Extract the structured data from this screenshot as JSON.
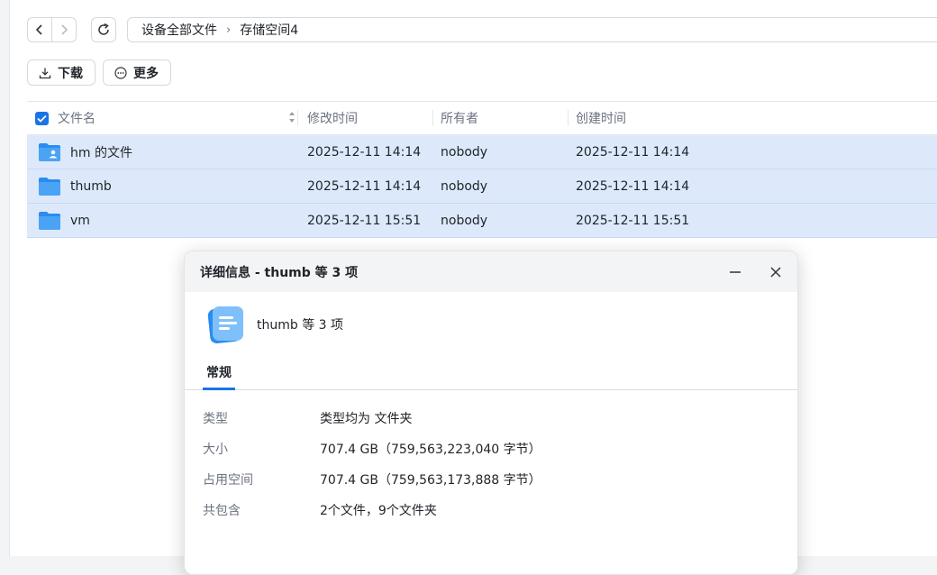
{
  "breadcrumb": {
    "root": "设备全部文件",
    "separator": "›",
    "current": "存储空间4"
  },
  "toolbar": {
    "download_label": "下载",
    "more_label": "更多"
  },
  "table": {
    "columns": {
      "name": "文件名",
      "modified": "修改时间",
      "owner": "所有者",
      "created": "创建时间"
    },
    "rows": [
      {
        "name": "hm 的文件",
        "modified": "2025-12-11 14:14",
        "owner": "nobody",
        "created": "2025-12-11 14:14",
        "icon": "user-folder-icon"
      },
      {
        "name": "thumb",
        "modified": "2025-12-11 14:14",
        "owner": "nobody",
        "created": "2025-12-11 14:14",
        "icon": "folder-icon"
      },
      {
        "name": "vm",
        "modified": "2025-12-11 15:51",
        "owner": "nobody",
        "created": "2025-12-11 15:51",
        "icon": "folder-icon"
      }
    ]
  },
  "dialog": {
    "title": "详细信息 - thumb 等 3 项",
    "summary_title": "thumb 等 3 项",
    "tab_general": "常规",
    "properties": [
      {
        "label": "类型",
        "value": "类型均为 文件夹"
      },
      {
        "label": "大小",
        "value": "707.4 GB（759,563,223,040 字节）"
      },
      {
        "label": "占用空间",
        "value": "707.4 GB（759,563,173,888 字节）"
      },
      {
        "label": "共包含",
        "value": "2个文件，9个文件夹"
      }
    ]
  },
  "colors": {
    "accent": "#1a73e8",
    "selected_row": "#dde9fb",
    "folder": "#2a8cf0"
  }
}
